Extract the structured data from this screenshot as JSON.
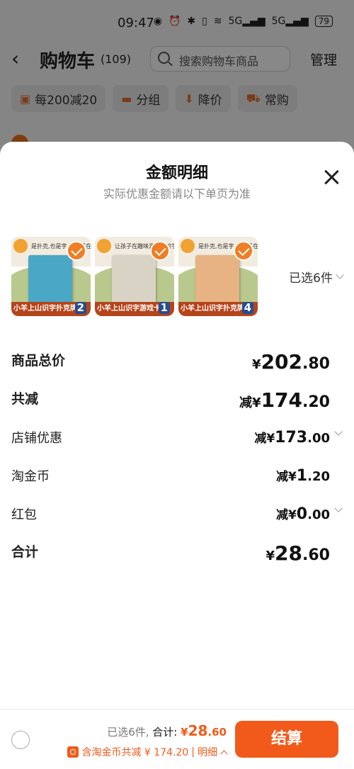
{
  "status_bar": {
    "time": "09:47",
    "network": "5G",
    "battery": "79"
  },
  "header": {
    "title": "购物车",
    "count": "(109)",
    "search_placeholder": "搜索购物车商品",
    "manage": "管理"
  },
  "filters": [
    {
      "label": "每200减20",
      "icon": "coupon-icon"
    },
    {
      "label": "分组",
      "icon": "folder-icon"
    },
    {
      "label": "降价",
      "icon": "price-drop-icon"
    },
    {
      "label": "常购",
      "icon": "cart-icon"
    }
  ],
  "sheet": {
    "title": "金额明细",
    "subtitle": "实际优惠金额请以下单页为准",
    "selected_summary": "已选6件",
    "products": [
      {
        "caption": "小羊上山识字扑克牌",
        "top_text": "是扑克,也是字 让孩子在趣味游戏中",
        "qty": "2",
        "box_color": "#4aa7c6",
        "checked": true
      },
      {
        "caption": "小羊上山识字游戏卡",
        "top_text": "让孩子在趣味游戏中识字",
        "qty": "1",
        "box_color": "#d9d3c6",
        "checked": true
      },
      {
        "caption": "小羊上山识字扑克牌",
        "top_text": "是扑克,也是字 让孩子在趣味游戏中",
        "qty": "4",
        "box_color": "#e7b383",
        "checked": true
      }
    ],
    "rows": [
      {
        "label": "商品总价",
        "prefix": "¥",
        "int": "202",
        "dec": ".80"
      },
      {
        "label": "共减",
        "prefix": "减¥",
        "int": "174",
        "dec": ".20"
      },
      {
        "label": "店铺优惠",
        "prefix": "减¥",
        "int": "173",
        "dec": ".00"
      },
      {
        "label": "淘金币",
        "prefix": "减¥",
        "int": "1",
        "dec": ".20"
      },
      {
        "label": "红包",
        "prefix": "减¥",
        "int": "0",
        "dec": ".00"
      },
      {
        "label": "合计",
        "prefix": "¥",
        "int": "28",
        "dec": ".60"
      }
    ]
  },
  "bottom_bar": {
    "selected": "已选6件,",
    "total_label": "合计:",
    "total_prefix": "¥",
    "total_int": "28",
    "total_dec": ".60",
    "discount_text": "含淘金币共减 ¥ 174.20",
    "detail_link": "明细",
    "checkout": "结算"
  },
  "colors": {
    "accent": "#f15a1a",
    "check": "#f07e25"
  }
}
